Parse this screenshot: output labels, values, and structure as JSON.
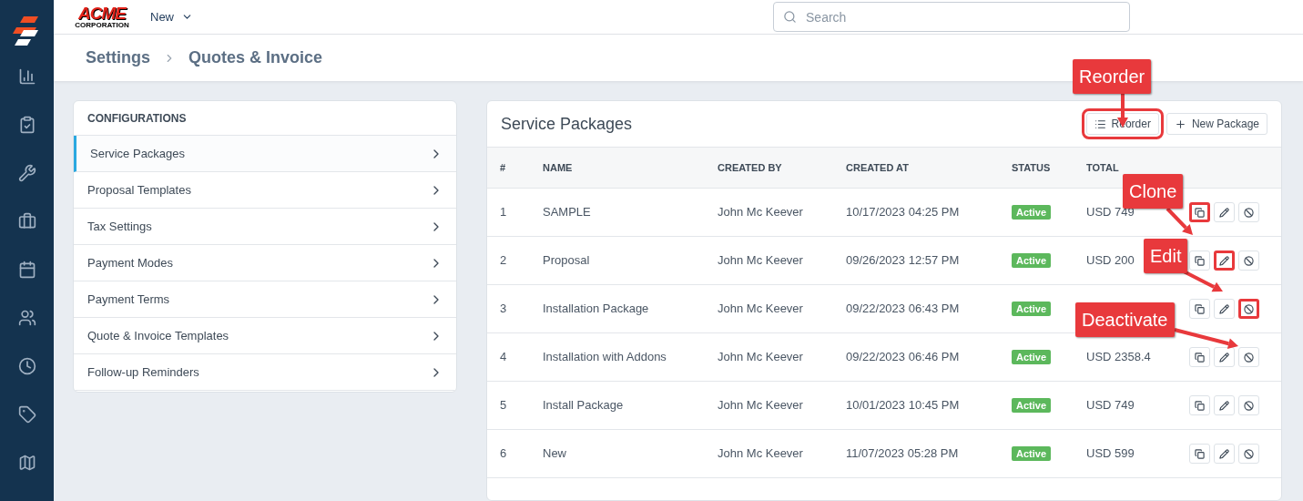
{
  "logo": {
    "name": "ACME",
    "sub": "CORPORATION"
  },
  "top_bar": {
    "new_menu": "New",
    "search": {
      "placeholder": "Search"
    }
  },
  "sidebar": {
    "items": [
      {
        "kind": "chart"
      },
      {
        "kind": "clipboard"
      },
      {
        "kind": "tools"
      },
      {
        "kind": "briefcase"
      },
      {
        "kind": "calendar"
      },
      {
        "kind": "users"
      },
      {
        "kind": "clock"
      },
      {
        "kind": "tag"
      },
      {
        "kind": "map"
      }
    ]
  },
  "breadcrumb": [
    "Settings",
    "Quotes & Invoice"
  ],
  "configurations": {
    "title": "CONFIGURATIONS",
    "items": [
      {
        "label": "Service Packages",
        "selected": true
      },
      {
        "label": "Proposal Templates",
        "selected": false
      },
      {
        "label": "Tax Settings",
        "selected": false
      },
      {
        "label": "Payment Modes",
        "selected": false
      },
      {
        "label": "Payment Terms",
        "selected": false
      },
      {
        "label": "Quote & Invoice Templates",
        "selected": false
      },
      {
        "label": "Follow-up Reminders",
        "selected": false
      }
    ]
  },
  "packages": {
    "title": "Service Packages",
    "buttons": [
      {
        "kind": "reorder",
        "label": "Reorder",
        "highlighted": true
      },
      {
        "kind": "new",
        "label": "New Package",
        "highlighted": false
      }
    ],
    "columns": [
      "#",
      "NAME",
      "CREATED BY",
      "CREATED AT",
      "STATUS",
      "TOTAL"
    ],
    "rows": [
      {
        "num": "1",
        "name": "SAMPLE",
        "created_by": "John Mc Keever",
        "created_at": "10/17/2023 04:25 PM",
        "status": "Active",
        "total": "USD 749",
        "actions": [
          {
            "kind": "clone",
            "highlighted": true
          },
          {
            "kind": "edit",
            "highlighted": false
          },
          {
            "kind": "deactivate",
            "highlighted": false
          }
        ]
      },
      {
        "num": "2",
        "name": "Proposal",
        "created_by": "John Mc Keever",
        "created_at": "09/26/2023 12:57 PM",
        "status": "Active",
        "total": "USD 200",
        "actions": [
          {
            "kind": "clone",
            "highlighted": false
          },
          {
            "kind": "edit",
            "highlighted": true
          },
          {
            "kind": "deactivate",
            "highlighted": false
          }
        ]
      },
      {
        "num": "3",
        "name": "Installation Package",
        "created_by": "John Mc Keever",
        "created_at": "09/22/2023 06:43 PM",
        "status": "Active",
        "actions": [
          {
            "kind": "clone",
            "highlighted": false
          },
          {
            "kind": "edit",
            "highlighted": false
          },
          {
            "kind": "deactivate",
            "highlighted": true
          }
        ]
      },
      {
        "num": "4",
        "name": "Installation with Addons",
        "created_by": "John Mc Keever",
        "created_at": "09/22/2023 06:46 PM",
        "status": "Active",
        "total": "USD 2358.4",
        "actions": [
          {
            "kind": "clone",
            "highlighted": false
          },
          {
            "kind": "edit",
            "highlighted": false
          },
          {
            "kind": "deactivate",
            "highlighted": false
          }
        ]
      },
      {
        "num": "5",
        "name": "Install Package",
        "created_by": "John Mc Keever",
        "created_at": "10/01/2023 10:45 PM",
        "status": "Active",
        "total": "USD 749",
        "actions": [
          {
            "kind": "clone",
            "highlighted": false
          },
          {
            "kind": "edit",
            "highlighted": false
          },
          {
            "kind": "deactivate",
            "highlighted": false
          }
        ]
      },
      {
        "num": "6",
        "name": "New",
        "created_by": "John Mc Keever",
        "created_at": "11/07/2023 05:28 PM",
        "status": "Active",
        "total": "USD 599",
        "actions": [
          {
            "kind": "clone",
            "highlighted": false
          },
          {
            "kind": "edit",
            "highlighted": false
          },
          {
            "kind": "deactivate",
            "highlighted": false
          }
        ]
      }
    ]
  },
  "annotations": [
    {
      "text": "Reorder"
    },
    {
      "text": "Clone"
    },
    {
      "text": "Edit"
    },
    {
      "text": "Deactivate"
    }
  ]
}
